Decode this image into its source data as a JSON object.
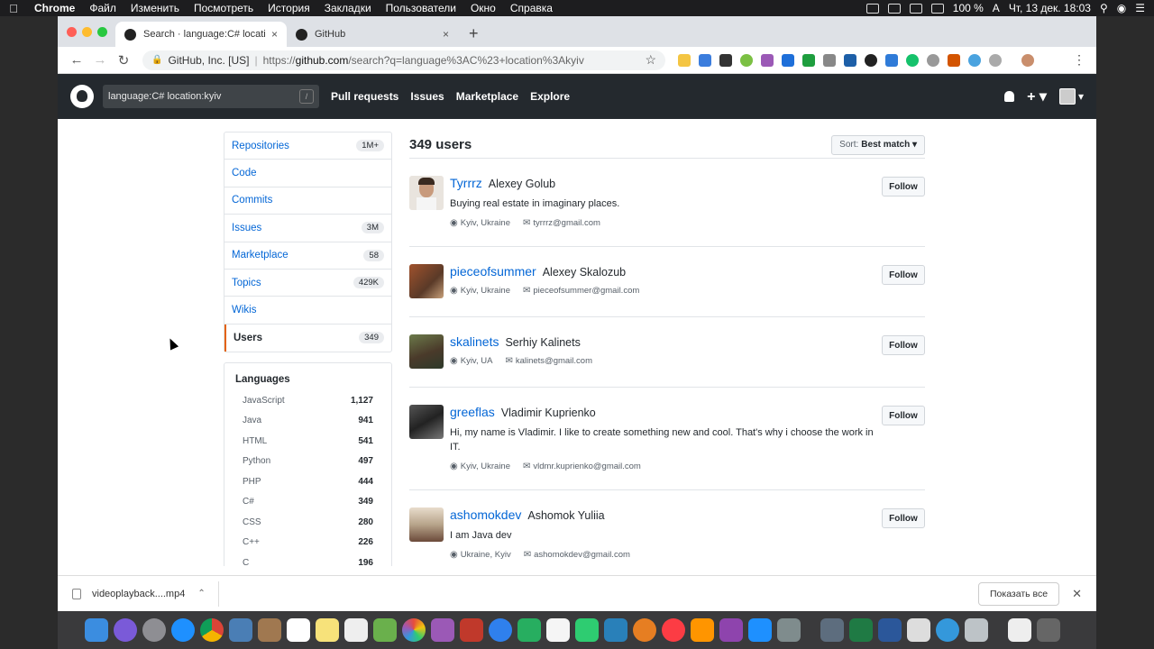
{
  "menubar": {
    "app": "Chrome",
    "items": [
      "Файл",
      "Изменить",
      "Посмотреть",
      "История",
      "Закладки",
      "Пользователи",
      "Окно",
      "Справка"
    ],
    "battery": "100 %",
    "input_source": "A",
    "clock": "Чт, 13 дек.  18:03"
  },
  "tabs": [
    {
      "title": "Search · language:C# location:kyiv",
      "close": "×"
    },
    {
      "title": "GitHub",
      "close": "×"
    }
  ],
  "new_tab": "+",
  "omnibox": {
    "org": "GitHub, Inc. [US]",
    "url_scheme": "https://",
    "url_host": "github.com",
    "url_rest": "/search?q=language%3AC%23+location%3Akyiv"
  },
  "github": {
    "search_value": "language:C# location:kyiv",
    "search_shortcut": "/",
    "nav": [
      "Pull requests",
      "Issues",
      "Marketplace",
      "Explore"
    ]
  },
  "sidebar": {
    "items": [
      {
        "label": "Repositories",
        "count": "1M+"
      },
      {
        "label": "Code",
        "count": ""
      },
      {
        "label": "Commits",
        "count": ""
      },
      {
        "label": "Issues",
        "count": "3M"
      },
      {
        "label": "Marketplace",
        "count": "58"
      },
      {
        "label": "Topics",
        "count": "429K"
      },
      {
        "label": "Wikis",
        "count": ""
      },
      {
        "label": "Users",
        "count": "349"
      }
    ],
    "selected": "Users",
    "languages_title": "Languages",
    "languages": [
      {
        "name": "JavaScript",
        "count": "1,127"
      },
      {
        "name": "Java",
        "count": "941"
      },
      {
        "name": "HTML",
        "count": "541"
      },
      {
        "name": "Python",
        "count": "497"
      },
      {
        "name": "PHP",
        "count": "444"
      },
      {
        "name": "C#",
        "count": "349"
      },
      {
        "name": "CSS",
        "count": "280"
      },
      {
        "name": "C++",
        "count": "226"
      },
      {
        "name": "C",
        "count": "196"
      }
    ]
  },
  "results": {
    "count_label": "349 users",
    "sort_prefix": "Sort:",
    "sort_value": "Best match ▾",
    "follow_label": "Follow",
    "users": [
      {
        "login": "Tyrrrz",
        "name": "Alexey Golub",
        "bio": "Buying real estate in imaginary places.",
        "location": "Kyiv, Ukraine",
        "email": "tyrrrz@gmail.com",
        "avatar_color": "#e9e4de"
      },
      {
        "login": "pieceofsummer",
        "name": "Alexey Skalozub",
        "bio": "",
        "location": "Kyiv, Ukraine",
        "email": "pieceofsummer@gmail.com",
        "avatar_color": "#8a5a3a"
      },
      {
        "login": "skalinets",
        "name": "Serhiy Kalinets",
        "bio": "",
        "location": "Kyiv, UA",
        "email": "kalinets@gmail.com",
        "avatar_color": "#4f5a3c"
      },
      {
        "login": "greeflas",
        "name": "Vladimir Kuprienko",
        "bio": "Hi, my name is Vladimir. I like to create something new and cool. That's why i choose the work in IT.",
        "location": "Kyiv, Ukraine",
        "email": "vldmr.kuprienko@gmail.com",
        "avatar_color": "#3c3c3c"
      },
      {
        "login": "ashomokdev",
        "name": "Ashomok Yuliia",
        "bio": "I am Java dev",
        "location": "Ukraine, Kyiv",
        "email": "ashomokdev@gmail.com",
        "avatar_color": "#b7a48a"
      }
    ]
  },
  "download": {
    "filename": "videoplayback....mp4",
    "show_all": "Показать все"
  }
}
